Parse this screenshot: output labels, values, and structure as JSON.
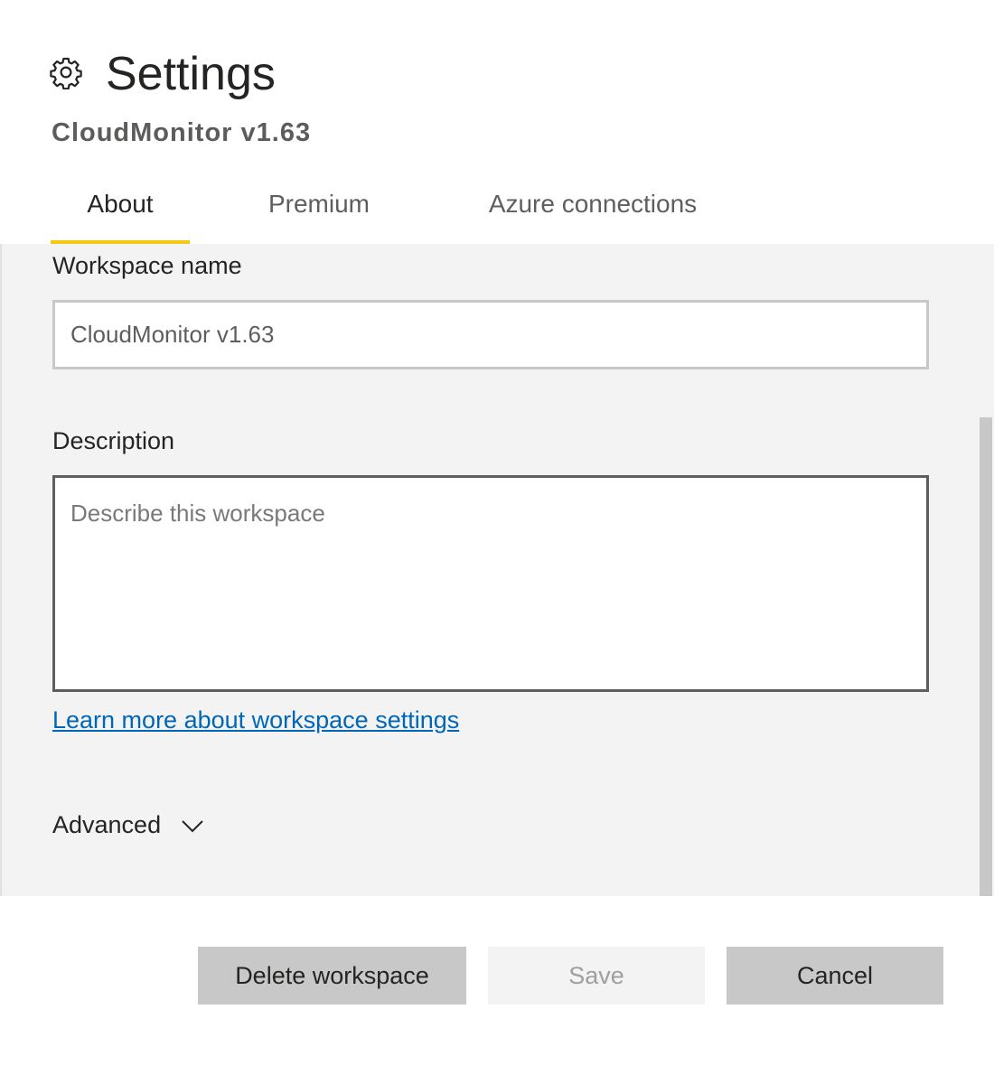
{
  "header": {
    "title": "Settings",
    "subtitle": "CloudMonitor v1.63",
    "icon": "gear-icon"
  },
  "tabs": [
    {
      "label": "About",
      "active": true
    },
    {
      "label": "Premium",
      "active": false
    },
    {
      "label": "Azure connections",
      "active": false
    }
  ],
  "form": {
    "workspace_name_label": "Workspace name",
    "workspace_name_value": "CloudMonitor v1.63",
    "description_label": "Description",
    "description_placeholder": "Describe this workspace",
    "learn_more_link": "Learn more about workspace settings",
    "advanced_label": "Advanced"
  },
  "footer": {
    "delete_label": "Delete workspace",
    "save_label": "Save",
    "cancel_label": "Cancel"
  },
  "colors": {
    "accent_tab_underline": "#f2c811",
    "link": "#0067b8",
    "panel_bg": "#f3f3f3",
    "button_bg": "#c8c8c8"
  }
}
